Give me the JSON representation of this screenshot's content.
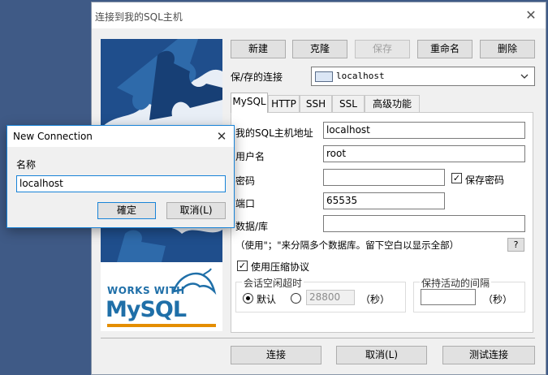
{
  "main_window": {
    "title": "连接到我的SQL主机",
    "close_glyph": "✕"
  },
  "side_image": {
    "caption_top": "WORKS WITH",
    "logo_text": "MySQL",
    "colors": {
      "brand_blue": "#1f6fa8",
      "brand_orange": "#e48e00",
      "puzzle_blue": "#1f4e8c"
    }
  },
  "toolbar": {
    "new_label": "新建",
    "clone_label": "克隆",
    "save_label": "保存",
    "rename_label": "重命名",
    "delete_label": "删除"
  },
  "saved_connection": {
    "label": "保/存的连接",
    "value": "localhost"
  },
  "tabs": [
    "MySQL",
    "HTTP",
    "SSH",
    "SSL",
    "高级功能"
  ],
  "form": {
    "host_label": "我的SQL主机地址",
    "host_value": "localhost",
    "user_label": "用户名",
    "user_value": "root",
    "password_label": "密码",
    "password_value": "",
    "save_password_label": "保存密码",
    "port_label": "端口",
    "port_value": "65535",
    "database_label": "数据/库",
    "database_value": "",
    "database_hint": "（使用\"；\"来分隔多个数据库。留下空白以显示全部）",
    "help_label": "?",
    "compression_label": "使用压缩协议",
    "session_group_title": "会话空闲超时",
    "default_radio_label": "默认",
    "timeout_value": "28800",
    "seconds_label": "（秒）",
    "keepalive_group_title": "保持活动的间隔",
    "keepalive_value": "",
    "keepalive_seconds_label": "（秒）"
  },
  "bottom_buttons": {
    "connect_label": "连接",
    "cancel_label": "取消(L)",
    "test_label": "测试连接"
  },
  "new_connection_dialog": {
    "title": "New Connection",
    "close_glyph": "✕",
    "name_label": "名称",
    "name_value": "localhost",
    "ok_label": "確定",
    "cancel_label": "取消(L)"
  }
}
